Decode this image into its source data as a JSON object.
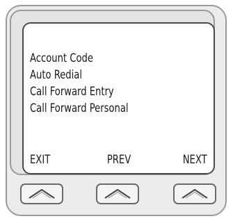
{
  "menu": {
    "items": [
      {
        "label": "Account Code"
      },
      {
        "label": "Auto Redial"
      },
      {
        "label": "Call Forward Entry"
      },
      {
        "label": "Call Forward Personal"
      }
    ]
  },
  "softkeys": {
    "exit_label": "EXIT",
    "prev_label": "PREV",
    "next_label": "NEXT"
  },
  "buttons": [
    {
      "icon": "chevron-up-icon"
    },
    {
      "icon": "chevron-up-icon"
    },
    {
      "icon": "chevron-up-icon"
    }
  ]
}
